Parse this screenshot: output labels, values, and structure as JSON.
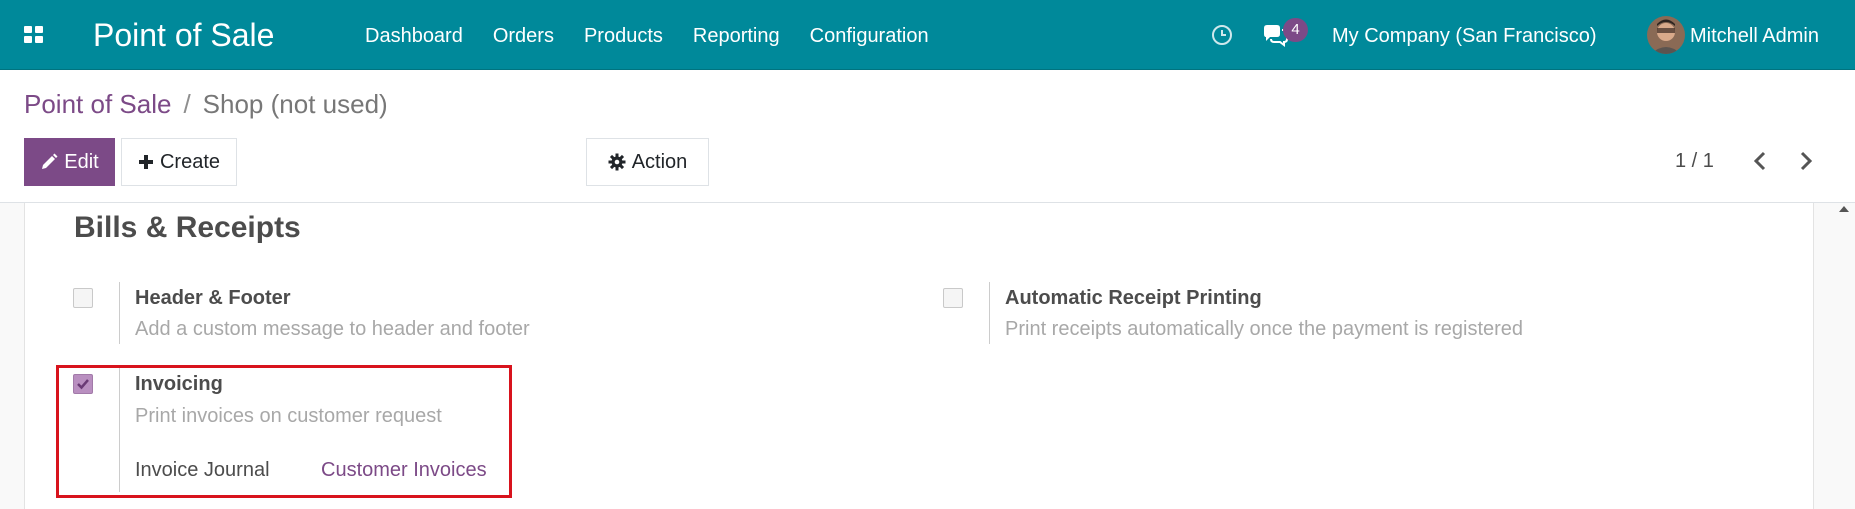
{
  "navbar": {
    "app_title": "Point of Sale",
    "menu": [
      {
        "label": "Dashboard"
      },
      {
        "label": "Orders"
      },
      {
        "label": "Products"
      },
      {
        "label": "Reporting"
      },
      {
        "label": "Configuration"
      }
    ],
    "chat_count": "4",
    "company": "My Company (San Francisco)",
    "user": "Mitchell Admin",
    "icons": {
      "apps": "grid-icon",
      "activity": "clock-icon",
      "messages": "chat-icon"
    }
  },
  "breadcrumb": {
    "parent": "Point of Sale",
    "separator": "/",
    "current": "Shop (not used)"
  },
  "toolbar": {
    "edit_label": "Edit",
    "create_label": "Create",
    "action_label": "Action"
  },
  "pager": {
    "value": "1 / 1"
  },
  "section": {
    "title": "Bills & Receipts",
    "settings": [
      {
        "title": "Header & Footer",
        "description": "Add a custom message to header and footer",
        "checked": false
      },
      {
        "title": "Automatic Receipt Printing",
        "description": "Print receipts automatically once the payment is registered",
        "checked": false
      },
      {
        "title": "Invoicing",
        "description": "Print invoices on customer request",
        "checked": true,
        "field_label": "Invoice Journal",
        "field_value": "Customer Invoices"
      }
    ]
  },
  "colors": {
    "navbar": "#00899a",
    "primary": "#7c4a87",
    "highlight": "#d8131d"
  }
}
